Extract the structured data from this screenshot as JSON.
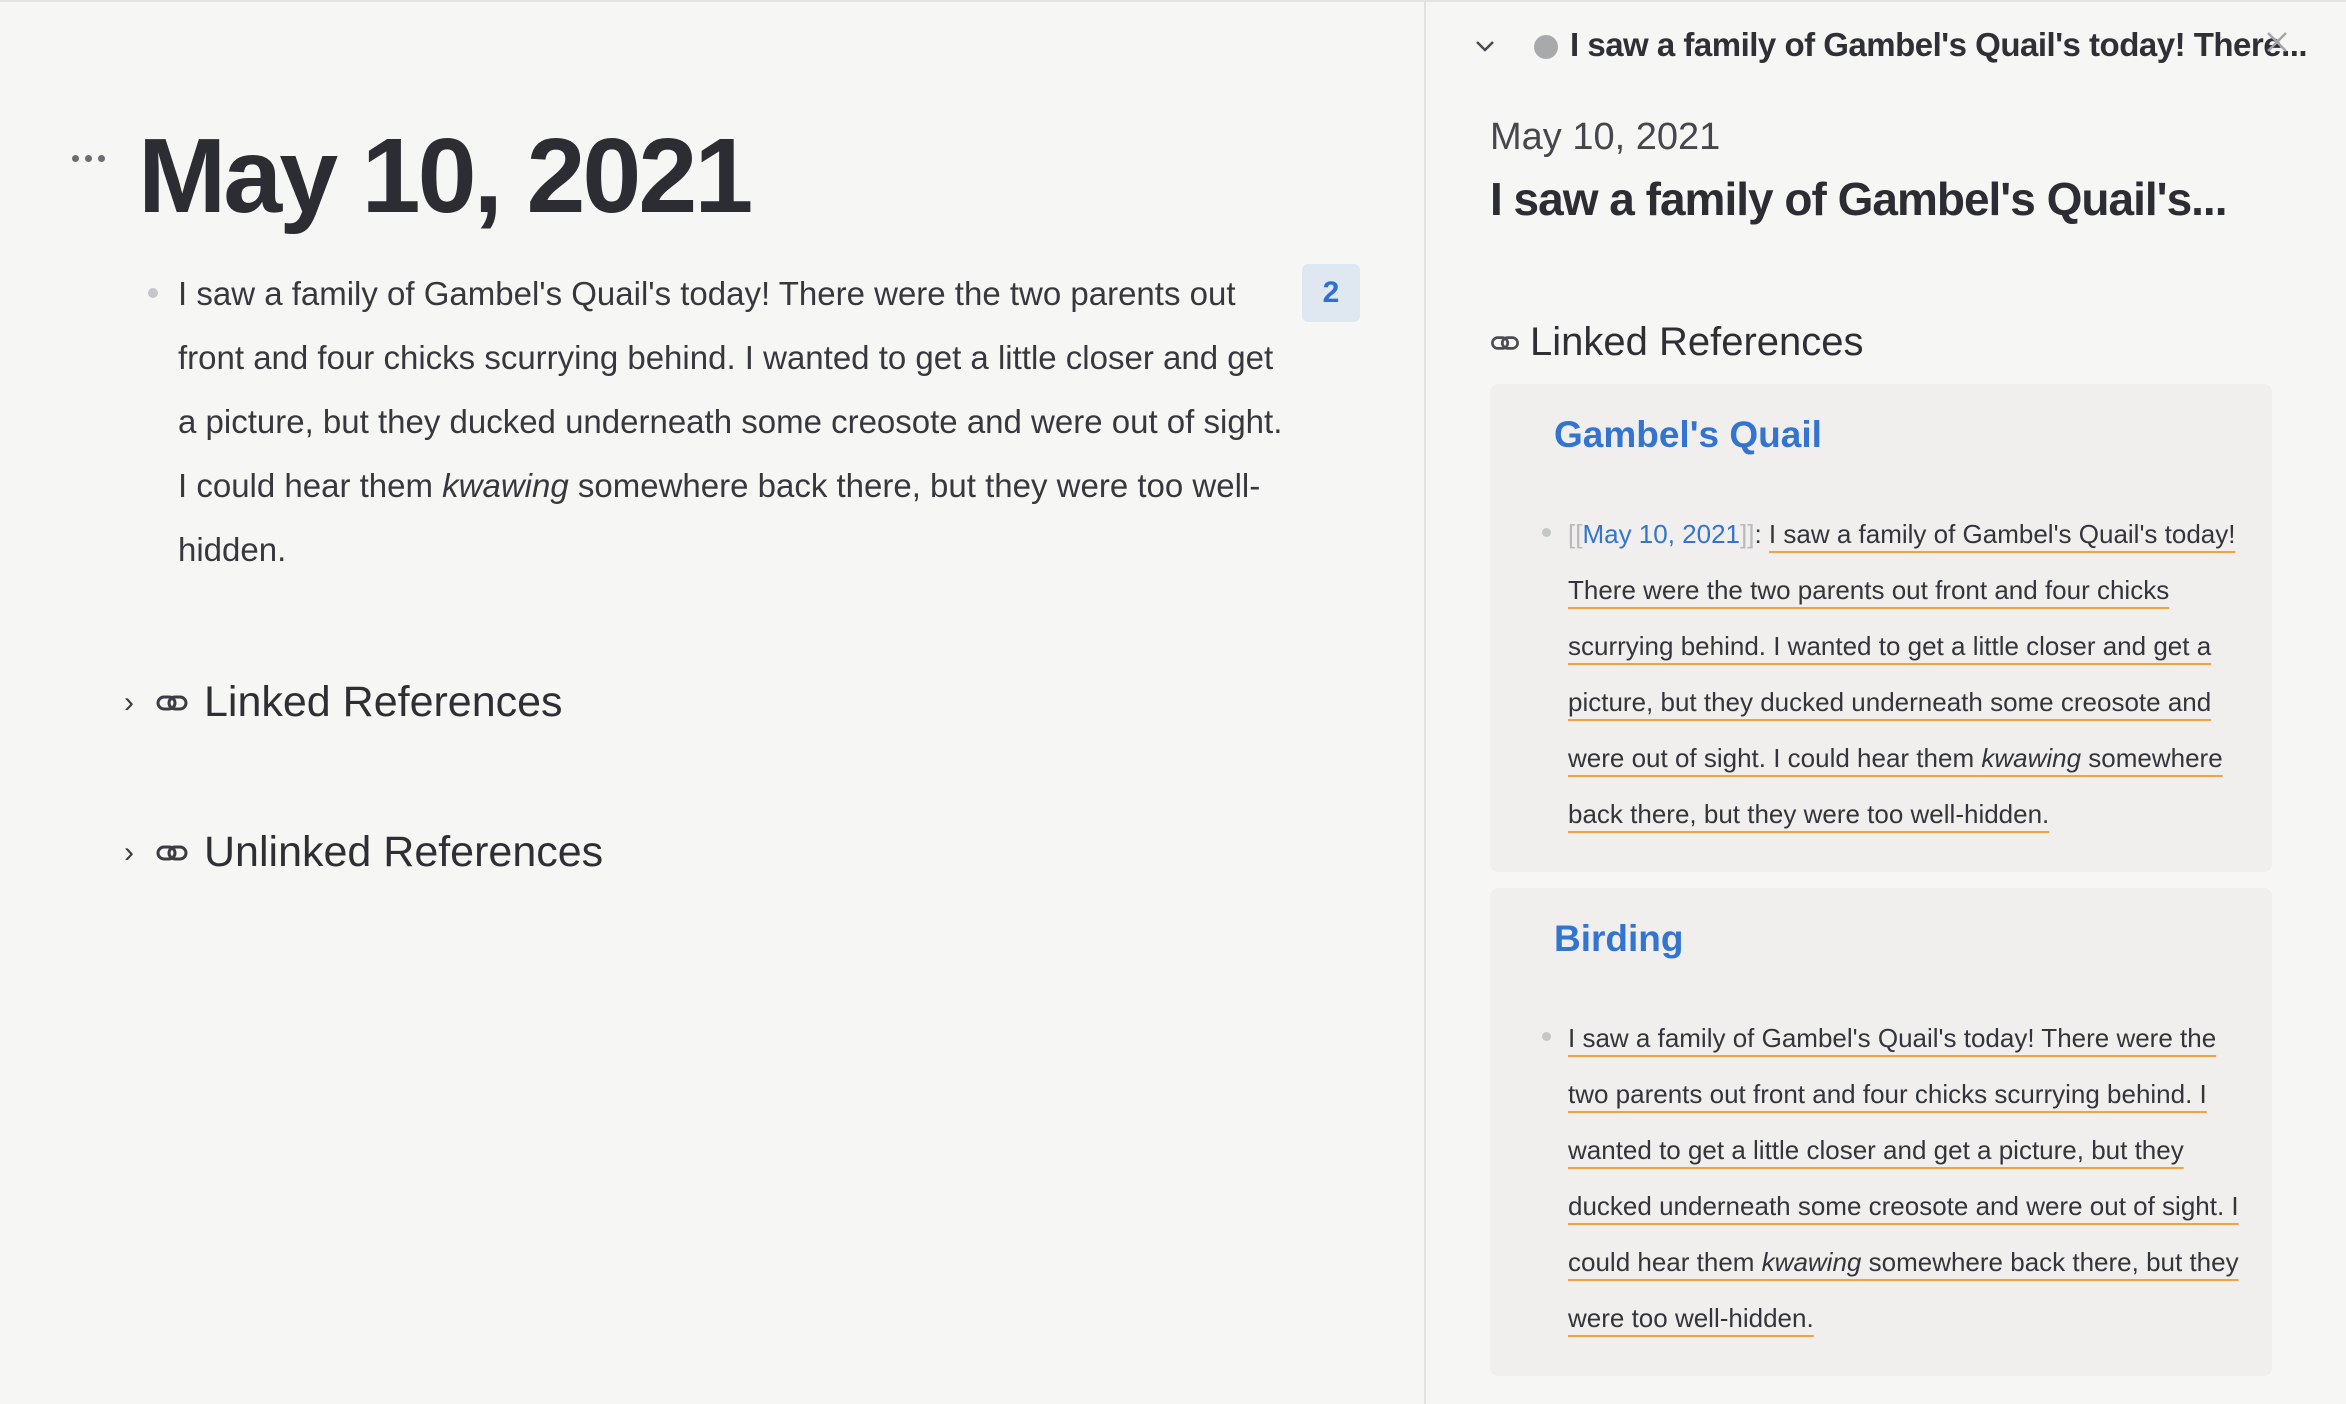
{
  "main": {
    "title": "May 10, 2021",
    "block": {
      "text_before": "I saw a family of Gambel's Quail's today! There were the two parents out front and four chicks scurrying behind. I wanted to get a little closer and get a picture, but they ducked underneath some creosote and were out of sight. I could hear them ",
      "text_italic": "kwawing",
      "text_after": " somewhere back there, but they were too well-hidden.",
      "ref_count": "2"
    },
    "linked_references_label": "Linked References",
    "unlinked_references_label": "Unlinked References"
  },
  "sidebar": {
    "header_title": "I saw a family of Gambel's Quail's today! There...",
    "date": "May 10, 2021",
    "block_title": "I saw a family of Gambel's Quail's...",
    "linked_references_label": "Linked References",
    "refs": [
      {
        "page": "Gambel's Quail",
        "link_open": "[[",
        "link_text": "May 10, 2021",
        "link_close": "]]",
        "colon": ": ",
        "text_before": "I saw a family of Gambel's Quail's today! There were the two parents out front and four chicks scurrying behind. I wanted to get a little closer and get a picture, but they ducked underneath some creosote and were out of sight. I could hear them ",
        "text_italic": "kwawing",
        "text_after": " somewhere back there, but they were too well-hidden."
      },
      {
        "page": "Birding",
        "text_before": "I saw a family of Gambel's Quail's today! There were the two parents out front and four chicks scurrying behind. I wanted to get a little closer and get a picture, but they ducked underneath some creosote and were out of sight. I could hear them ",
        "text_italic": "kwawing",
        "text_after": " somewhere back there, but they were too well-hidden."
      }
    ]
  },
  "icons": {
    "page_menu": "more-horizontal-icon",
    "expand": "chevron-right-icon",
    "link": "link-icon",
    "collapse": "chevron-down-icon",
    "close": "close-icon"
  },
  "colors": {
    "link_blue": "#3274d0",
    "underline_orange": "#f0a14a",
    "background": "#f6f6f5",
    "ref_card": "#f0efee"
  }
}
